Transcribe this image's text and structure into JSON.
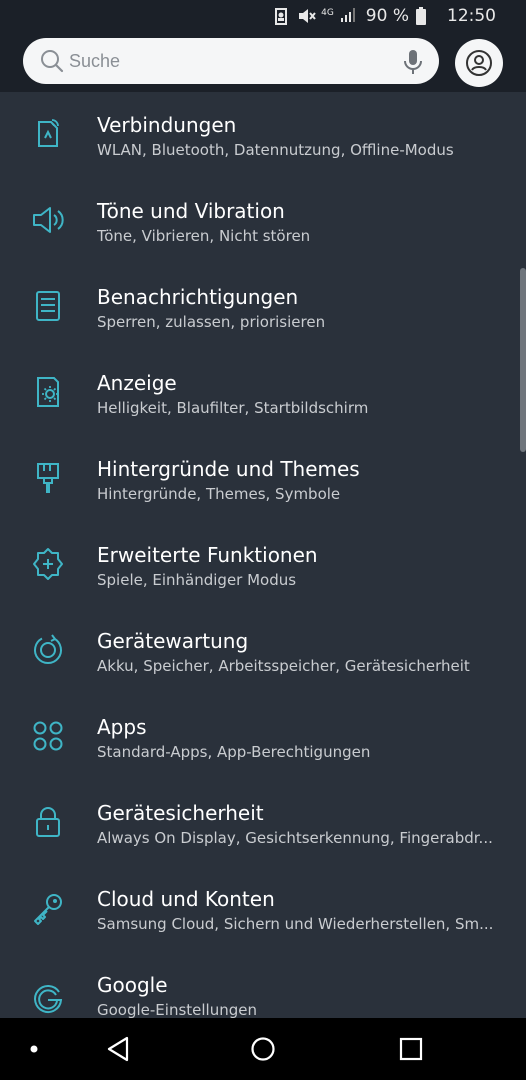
{
  "status_bar": {
    "network": "4G",
    "battery_percent": "90 %",
    "time": "12:50"
  },
  "search": {
    "placeholder": "Suche"
  },
  "settings": [
    {
      "title": "Verbindungen",
      "subtitle": "WLAN, Bluetooth, Datennutzung, Offline-Modus",
      "icon": "connections-icon"
    },
    {
      "title": "Töne und Vibration",
      "subtitle": "Töne, Vibrieren, Nicht stören",
      "icon": "speaker-icon"
    },
    {
      "title": "Benachrichtigungen",
      "subtitle": "Sperren, zulassen, priorisieren",
      "icon": "notifications-icon"
    },
    {
      "title": "Anzeige",
      "subtitle": "Helligkeit, Blaufilter, Startbildschirm",
      "icon": "display-icon"
    },
    {
      "title": "Hintergründe und Themes",
      "subtitle": "Hintergründe, Themes, Symbole",
      "icon": "brush-icon"
    },
    {
      "title": "Erweiterte Funktionen",
      "subtitle": "Spiele, Einhändiger Modus",
      "icon": "advanced-features-icon"
    },
    {
      "title": "Gerätewartung",
      "subtitle": "Akku, Speicher, Arbeitsspeicher, Gerätesicherheit",
      "icon": "device-care-icon"
    },
    {
      "title": "Apps",
      "subtitle": "Standard-Apps, App-Berechtigungen",
      "icon": "apps-icon"
    },
    {
      "title": "Gerätesicherheit",
      "subtitle": "Always On Display, Gesichtserkennung, Fingerabdr...",
      "icon": "lock-icon"
    },
    {
      "title": "Cloud und Konten",
      "subtitle": "Samsung Cloud, Sichern und Wiederherstellen, Sm...",
      "icon": "key-icon"
    },
    {
      "title": "Google",
      "subtitle": "Google-Einstellungen",
      "icon": "google-icon"
    }
  ],
  "colors": {
    "background": "#2a313b",
    "header": "#1b2028",
    "accent_icon": "#3fb5c6",
    "title": "#ffffff",
    "subtitle": "#c9ccd0"
  }
}
